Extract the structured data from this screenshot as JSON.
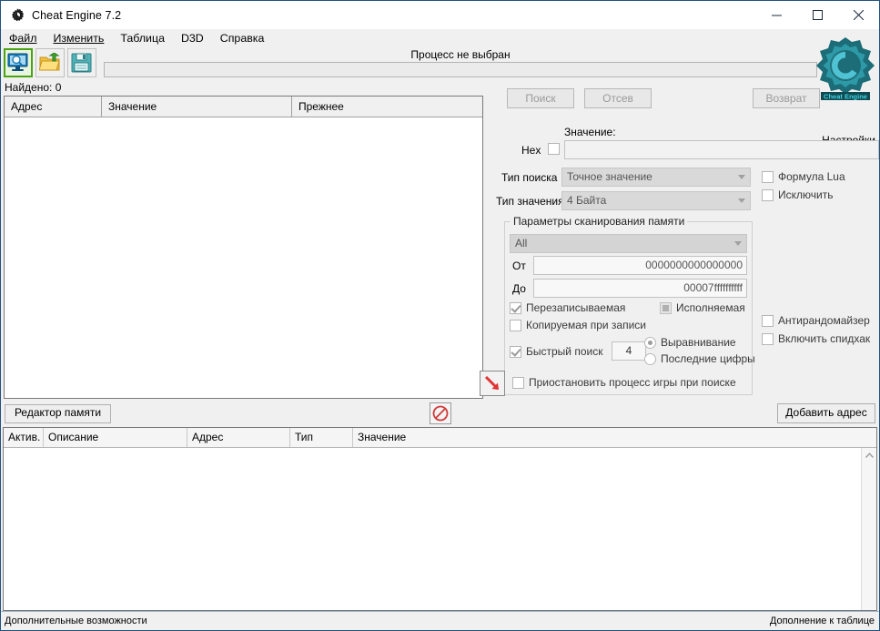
{
  "window": {
    "title": "Cheat Engine 7.2",
    "icon": "cheat-engine-icon",
    "minimize": "—",
    "maximize": "☐",
    "close": "×"
  },
  "menu": [
    {
      "label": "Файл",
      "underline": "Ф"
    },
    {
      "label": "Изменить",
      "underline": "И"
    },
    {
      "label": "Таблица",
      "underline": ""
    },
    {
      "label": "D3D",
      "underline": ""
    },
    {
      "label": "Справка",
      "underline": ""
    }
  ],
  "toolbar": {
    "buttons": [
      {
        "name": "open-process-button",
        "icon": "monitor-search-icon",
        "selected": true
      },
      {
        "name": "open-file-button",
        "icon": "open-folder-icon",
        "selected": false
      },
      {
        "name": "save-file-button",
        "icon": "floppy-save-icon",
        "selected": false
      }
    ],
    "process_label": "Процесс не выбран",
    "progress_value": ""
  },
  "results": {
    "found_label": "Найдено: 0",
    "columns": [
      "Адрес",
      "Значение",
      "Прежнее"
    ],
    "rows": []
  },
  "scan": {
    "search_button": "Поиск",
    "filter_button": "Отсев",
    "undo_button": "Возврат",
    "settings_label": "Настройки",
    "value_label": "Значение:",
    "hex_label": "Hex",
    "hex_checked": false,
    "value_input": "",
    "scan_type_label": "Тип поиска",
    "scan_type_value": "Точное значение",
    "value_type_label": "Тип значения",
    "value_type_value": "4 Байта",
    "lua_formula_label": "Формула Lua",
    "lua_formula_checked": false,
    "not_label": "Исключить",
    "not_checked": false,
    "antirandomizer_label": "Антирандомайзер",
    "antirandomizer_checked": false,
    "speedhack_label": "Включить спидхак",
    "speedhack_checked": false
  },
  "memscan": {
    "group_title": "Параметры сканирования памяти",
    "region_value": "All",
    "from_label": "От",
    "from_value": "0000000000000000",
    "to_label": "До",
    "to_value": "00007ffffffffff",
    "writable_label": "Перезаписываемая",
    "writable_state": "checked",
    "executable_label": "Исполняемая",
    "executable_state": "indeterminate",
    "copyonwrite_label": "Копируемая при записи",
    "copyonwrite_state": "unchecked",
    "fastscan_label": "Быстрый поиск",
    "fastscan_checked": true,
    "fastscan_value": "4",
    "alignment_label": "Выравнивание",
    "alignment_selected": true,
    "lastdigits_label": "Последние цифры",
    "lastdigits_selected": false,
    "pause_label": "Приостановить процесс игры при поиске",
    "pause_checked": false,
    "pause_icon": "red-arrow-icon"
  },
  "middle": {
    "memory_editor_button": "Редактор памяти",
    "add_address_button": "Добавить адрес",
    "no_icon": "prohibition-icon"
  },
  "addresslist": {
    "columns": [
      "Актив.",
      "Описание",
      "Адрес",
      "Тип",
      "Значение"
    ],
    "rows": []
  },
  "statusbar": {
    "left": "Дополнительные возможности",
    "right": "Дополнение к таблице"
  }
}
